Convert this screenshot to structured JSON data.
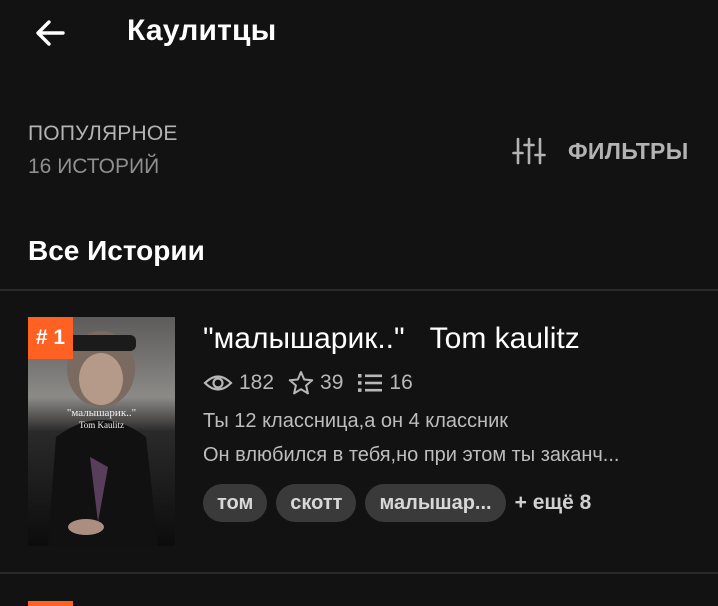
{
  "header": {
    "title": "Каулитцы"
  },
  "section": {
    "sort_label": "ПОПУЛЯРНОЕ",
    "count_label": "16 ИСТОРИЙ",
    "filters_label": "ФИЛЬТРЫ"
  },
  "all_stories_title": "Все Истории",
  "stories": [
    {
      "rank": "# 1",
      "cover_title": "\"малышарик..\"",
      "cover_author": "Tom Kaulitz",
      "title": "\"малышарик..\"   Tom kaulitz",
      "views": "182",
      "votes": "39",
      "parts": "16",
      "description_line1": "Ты 12 классница,а он 4 классник",
      "description_line2": "Он влюбился в тебя,но при этом ты заканч...",
      "tags": [
        "том",
        "скотт",
        "малышар..."
      ],
      "more_tags": "+ ещё 8"
    }
  ],
  "colors": {
    "background": "#121212",
    "accent": "#ff6122",
    "tag_bg": "#3a3a3a"
  }
}
